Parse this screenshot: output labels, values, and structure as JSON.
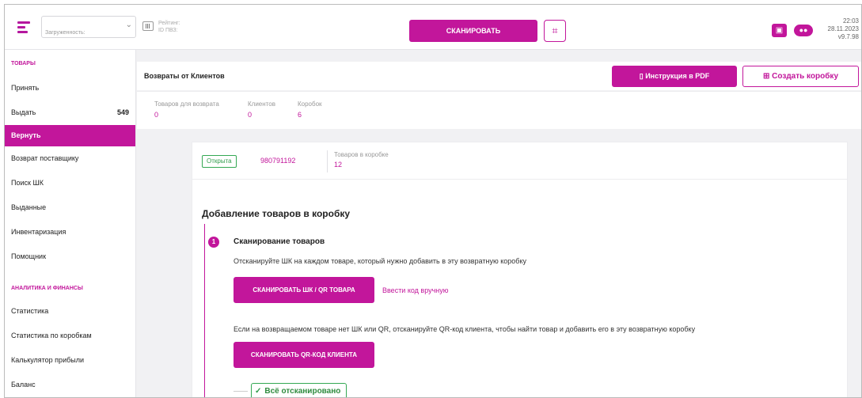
{
  "topbar": {
    "load_label": "Загруженность:",
    "rating_label": "Рейтинг:",
    "pvz_label": "ID ПВЗ:",
    "scan_button": "СКАНИРОВАТЬ",
    "time": "22:03",
    "date": "28.11.2023",
    "version": "v9.7.98"
  },
  "sidebar": {
    "section_goods": "ТОВАРЫ",
    "items_goods": [
      {
        "label": "Принять",
        "badge": ""
      },
      {
        "label": "Выдать",
        "badge": "549"
      },
      {
        "label": "Вернуть",
        "badge": ""
      },
      {
        "label": "Возврат поставщику",
        "badge": ""
      },
      {
        "label": "Поиск ШК",
        "badge": ""
      },
      {
        "label": "Выданные",
        "badge": ""
      },
      {
        "label": "Инвентаризация",
        "badge": ""
      },
      {
        "label": "Помощник",
        "badge": ""
      }
    ],
    "section_analytics": "АНАЛИТИКА И ФИНАНСЫ",
    "items_analytics": [
      {
        "label": "Статистика"
      },
      {
        "label": "Статистика по коробкам"
      },
      {
        "label": "Калькулятор прибыли"
      },
      {
        "label": "Баланс"
      }
    ]
  },
  "main": {
    "title": "Возвраты от Клиентов",
    "pdf_button": "Инструкция в PDF",
    "create_box_button": "Создать коробку",
    "stats": [
      {
        "label": "Товаров для возврата",
        "value": "0"
      },
      {
        "label": "Клиентов",
        "value": "0"
      },
      {
        "label": "Коробок",
        "value": "6"
      }
    ]
  },
  "box": {
    "status": "Открыта",
    "id": "980791192",
    "items_label": "Товаров в коробке",
    "items_value": "12"
  },
  "add": {
    "title": "Добавление товаров в коробку",
    "step_number": "1",
    "step_title": "Сканирование товаров",
    "step_desc": "Отсканируйте ШК на каждом товаре, который нужно добавить в эту возвратную коробку",
    "scan_item_button": "СКАНИРОВАТЬ ШК / QR ТОВАРА",
    "manual_link": "Ввести код вручную",
    "qr_desc": "Если на возвращаемом товаре нет ШК или QR, отсканируйте QR-код клиента, чтобы найти товар и добавить его в эту возвратную коробку",
    "scan_client_button": "СКАНИРОВАТЬ QR-КОД КЛИЕНТА",
    "all_scanned": "Всё отсканировано"
  },
  "colors": {
    "accent": "#c2169b",
    "success": "#34a853"
  }
}
